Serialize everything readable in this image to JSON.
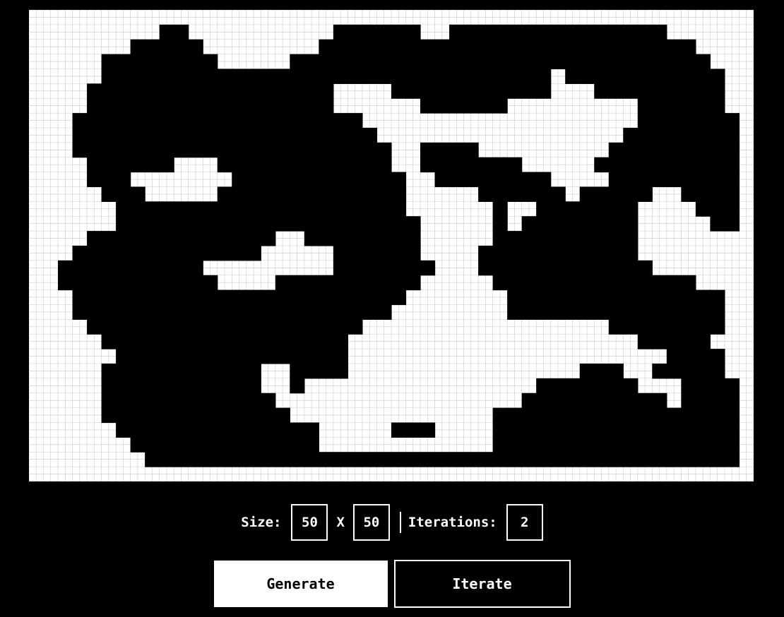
{
  "grid": {
    "cols": 50,
    "rows": 32,
    "wall_color": "#000000",
    "floor_color": "#ffffff",
    "gridline_color": "#c8c8c8",
    "cells": [
      "00000000000000000000000000000000000000000000000000",
      "00000000011000000000011111100111111111111111000000",
      "00000001111100000000111111111111111111111111110000",
      "00000111111110000011111111111111111111111111111000",
      "00000111111111111111111111111111111101111111111100",
      "00001111111111111111100001111111111100011111111100",
      "00001111111111111111100000011111100000000011111100",
      "00011111111111111111111000000000000000000011111110",
      "00011111111111111111111100000000000000000111111110",
      "00011111111111111111111110011110000000001111111110",
      "00001111110001111111111110011111110000011111111110",
      "00001110000000111111111111001111111100001111111110",
      "00000111000001111111111111000001111110111110011110",
      "00000011111111111111111111000000100111111100001110",
      "00000011111111111111111111100000101111111100000110",
      "00001111111111111001111111100000111111111100000000",
      "00011111111111110000011111100001111111111100000000",
      "00111111111100000000011111110001111111111110000000",
      "00111111111110000111111111100000111111111111110000",
      "00011111111111111111111111000000011111111111111100",
      "00011111111111111111111110000000011111111111111100",
      "00001111111111111111111000000000000000001111111100",
      "00000111111111111111110000000000000000000011111000",
      "00000011111111111111110000000000000000000000111100",
      "00000111111111110011110000000000000000111001111100",
      "00000111111111110010000000000000000111111100011110",
      "00000111111111111000000000000000001111111111011110",
      "00000111111111111100000000000000111111111111111110",
      "00000011111111111111000001110000111111111111111110",
      "00000001111111111111000000000000111111111111111110",
      "00000000111111111111111111111111111111111111111110",
      "00000000000000000000000000000000000000000000000000"
    ]
  },
  "controls": {
    "size_label": "Size:",
    "width_value": "50",
    "times_label": "X",
    "height_value": "50",
    "iterations_label": "Iterations:",
    "iterations_value": "2"
  },
  "buttons": {
    "generate_label": "Generate",
    "iterate_label": "Iterate"
  }
}
